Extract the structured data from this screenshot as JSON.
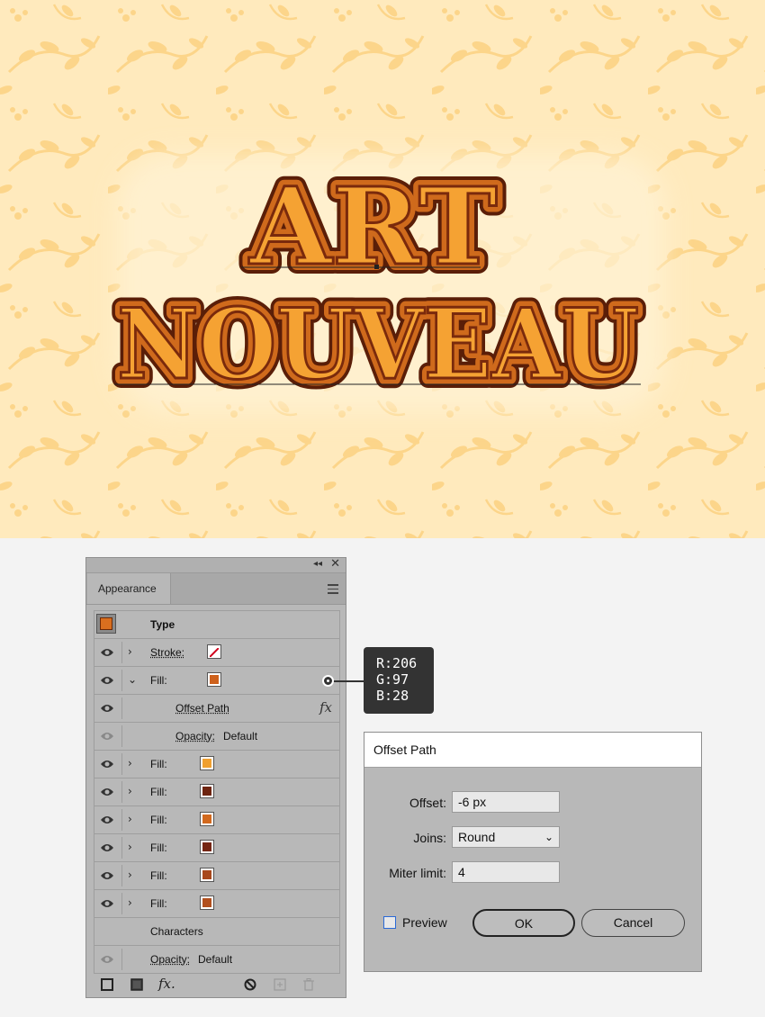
{
  "artwork": {
    "line1": "ART",
    "line2": "NOUVEAU",
    "background_color": "#ffeabd",
    "pattern_color": "#fdd990",
    "text_colors": {
      "outer": "#7a2a0c",
      "mid": "#cf6a1c",
      "inner": "#f5a233"
    }
  },
  "panel": {
    "title": "Appearance",
    "collapse_glyph": "◂◂",
    "close_glyph": "✕",
    "rows": [
      {
        "kind": "type",
        "label": "Type"
      },
      {
        "kind": "stroke",
        "label": "Stroke:",
        "swatch": "none"
      },
      {
        "kind": "fill",
        "label": "Fill:",
        "expanded": true,
        "swatch": "#ce611c"
      },
      {
        "kind": "effect",
        "label": "Offset Path",
        "icon": "fx-icon"
      },
      {
        "kind": "opacity",
        "label": "Opacity:",
        "value": "Default"
      },
      {
        "kind": "fill",
        "label": "Fill:",
        "swatch": "#f0a030"
      },
      {
        "kind": "fill",
        "label": "Fill:",
        "swatch": "#6e2410"
      },
      {
        "kind": "fill",
        "label": "Fill:",
        "swatch": "#d2691e"
      },
      {
        "kind": "fill",
        "label": "Fill:",
        "swatch": "#752614"
      },
      {
        "kind": "fill",
        "label": "Fill:",
        "swatch": "#a8481c"
      },
      {
        "kind": "fill",
        "label": "Fill:",
        "swatch": "#b2501e"
      },
      {
        "kind": "characters",
        "label": "Characters"
      },
      {
        "kind": "opacity",
        "label": "Opacity:",
        "value": "Default"
      }
    ],
    "footer_icons": [
      "add-stroke-icon",
      "add-fill-icon",
      "fx-menu-icon",
      "clear-appearance-icon",
      "duplicate-item-icon",
      "delete-icon"
    ]
  },
  "callout": {
    "r": "R:206",
    "g": "G:97",
    "b": "B:28"
  },
  "dialog": {
    "title": "Offset Path",
    "offset_label": "Offset:",
    "offset_value": "-6 px",
    "joins_label": "Joins:",
    "joins_value": "Round",
    "miter_label": "Miter limit:",
    "miter_value": "4",
    "preview_label": "Preview",
    "preview_checked": false,
    "ok_label": "OK",
    "cancel_label": "Cancel"
  }
}
